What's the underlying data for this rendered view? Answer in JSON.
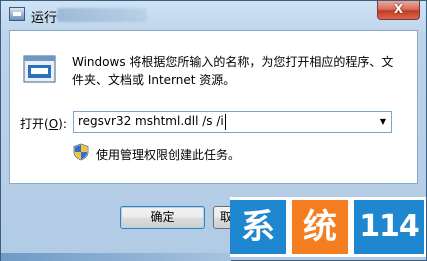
{
  "window": {
    "title": "运行",
    "close_glyph": "X"
  },
  "main": {
    "description": "Windows 将根据您所输入的名称，为您打开相应的程序、文件夹、文档或 Internet 资源。",
    "open_label_prefix": "打开(",
    "open_label_accel": "O",
    "open_label_suffix": "):",
    "command_value": "regsvr32 mshtml.dll /s /i",
    "admin_note": "使用管理权限创建此任务。"
  },
  "buttons": {
    "ok_label": "确定",
    "cancel_label": "取"
  },
  "watermark": {
    "char1": "系",
    "char2": "统",
    "char3": "114"
  },
  "colors": {
    "watermark_blue": "#1f86d0",
    "watermark_orange": "#f47d1f",
    "close_red": "#c43b24"
  },
  "icons": {
    "app": "run-dialog-icon",
    "run": "run-window-icon",
    "shield": "uac-shield-icon",
    "dropdown": "dropdown-arrow-icon"
  }
}
